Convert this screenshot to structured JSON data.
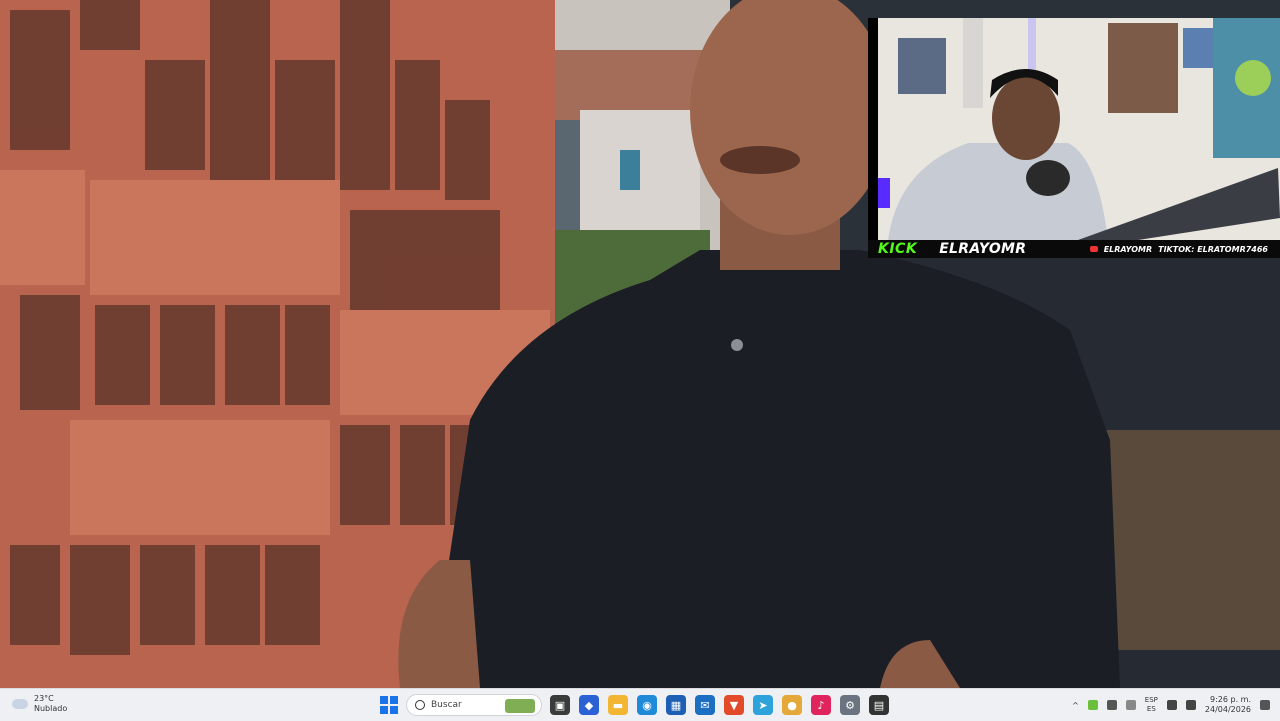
{
  "video": {
    "description_icon": "video-frame"
  },
  "stream_overlay": {
    "platform_label": "KICK",
    "streamer_name": "ELRAYOMR",
    "youtube_handle": "ELRAYOMR",
    "tiktok_label": "TIKTOK: ELRATOMR7466",
    "colors": {
      "kick": "#53fc18",
      "banner": "#0a0a0a"
    }
  },
  "taskbar": {
    "weather": {
      "temp": "23°C",
      "condition": "Nublado"
    },
    "search_placeholder": "Buscar",
    "apps": [
      {
        "name": "task-view-icon",
        "glyph": "▣",
        "color": "#3b3b3b"
      },
      {
        "name": "hp-app-icon",
        "glyph": "◆",
        "color": "#2a62d6"
      },
      {
        "name": "file-explorer-icon",
        "glyph": "▬",
        "color": "#f2b632"
      },
      {
        "name": "edge-icon",
        "glyph": "◉",
        "color": "#1f8ad8"
      },
      {
        "name": "store-icon",
        "glyph": "▦",
        "color": "#1c5fb5"
      },
      {
        "name": "outlook-icon",
        "glyph": "✉",
        "color": "#1b6ec2"
      },
      {
        "name": "brave-icon",
        "glyph": "▼",
        "color": "#e24a2a"
      },
      {
        "name": "telegram-icon",
        "glyph": "➤",
        "color": "#2ea2da"
      },
      {
        "name": "chrome-icon",
        "glyph": "●",
        "color": "#e5a93a"
      },
      {
        "name": "tiktok-icon",
        "glyph": "♪",
        "color": "#e0245e"
      },
      {
        "name": "settings-icon",
        "glyph": "⚙",
        "color": "#6b7380"
      },
      {
        "name": "game-app-icon",
        "glyph": "▤",
        "color": "#333"
      }
    ],
    "tray": {
      "language": "ESP",
      "region": "ES",
      "time": "9:26 p. m.",
      "date": "24/04/2026"
    }
  }
}
